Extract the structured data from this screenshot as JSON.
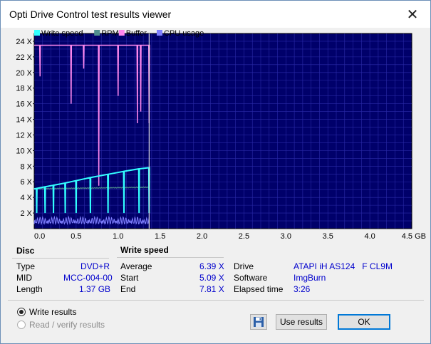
{
  "window": {
    "title": "Opti Drive Control test results viewer"
  },
  "chart_data": {
    "type": "line",
    "legend": [
      "Write speed",
      "RPM",
      "Buffer",
      "CPU usage"
    ],
    "legend_colors": [
      "#33ffff",
      "#4f8f8f",
      "#ff88ee",
      "#8080ff"
    ],
    "background": "#00006a",
    "grid": true,
    "xlim": [
      0,
      4.5
    ],
    "ylim": [
      0,
      25
    ],
    "x_ticks": [
      "0.0",
      "0.5",
      "1.0",
      "1.5",
      "2.0",
      "2.5",
      "3.0",
      "3.5",
      "4.0",
      "4.5 GB"
    ],
    "y_ticks": [
      "2 X",
      "4 X",
      "6 X",
      "8 X",
      "10 X",
      "12 X",
      "14 X",
      "16 X",
      "18 X",
      "20 X",
      "22 X",
      "24 X"
    ],
    "series": [
      {
        "name": "Write speed",
        "x": [
          0.0,
          0.2,
          0.4,
          0.6,
          0.8,
          1.0,
          1.2,
          1.37
        ],
        "values": [
          5.09,
          5.5,
          5.9,
          6.4,
          6.8,
          7.2,
          7.6,
          7.81
        ]
      },
      {
        "name": "RPM",
        "x": [
          0.0,
          1.37
        ],
        "values": [
          5.1,
          5.3
        ]
      },
      {
        "name": "Buffer",
        "x": [
          0.0,
          1.37
        ],
        "values": [
          23.5,
          23.5
        ]
      },
      {
        "name": "CPU usage",
        "x": [
          0.0,
          1.37
        ],
        "values": [
          0.8,
          0.8
        ]
      }
    ],
    "write_speed_dips_x": [
      0.03,
      0.13,
      0.23,
      0.37,
      0.5,
      0.67,
      0.88,
      1.07,
      1.25,
      1.37
    ],
    "buffer_dips": [
      {
        "x": 0.07,
        "value": 19.5
      },
      {
        "x": 0.44,
        "value": 16
      },
      {
        "x": 0.59,
        "value": 20.5
      },
      {
        "x": 0.77,
        "value": 5.5
      },
      {
        "x": 1.0,
        "value": 17
      },
      {
        "x": 1.23,
        "value": 13.5
      },
      {
        "x": 1.27,
        "value": 15
      },
      {
        "x": 1.37,
        "value": 13.5
      }
    ]
  },
  "disc": {
    "header": "Disc",
    "type_label": "Type",
    "type_value": "DVD+R",
    "mid_label": "MID",
    "mid_value": "MCC-004-00",
    "length_label": "Length",
    "length_value": "1.37 GB"
  },
  "write_speed": {
    "header": "Write speed",
    "average_label": "Average",
    "average_value": "6.39 X",
    "start_label": "Start",
    "start_value": "5.09 X",
    "end_label": "End",
    "end_value": "7.81 X"
  },
  "drive_info": {
    "drive_label": "Drive",
    "drive_value": "ATAPI iH AS124   F CL9M",
    "software_label": "Software",
    "software_value": "ImgBurn",
    "elapsed_label": "Elapsed time",
    "elapsed_value": "3:26"
  },
  "options": {
    "write_results": "Write results",
    "read_verify": "Read / verify results"
  },
  "buttons": {
    "use_results": "Use results",
    "ok": "OK"
  }
}
